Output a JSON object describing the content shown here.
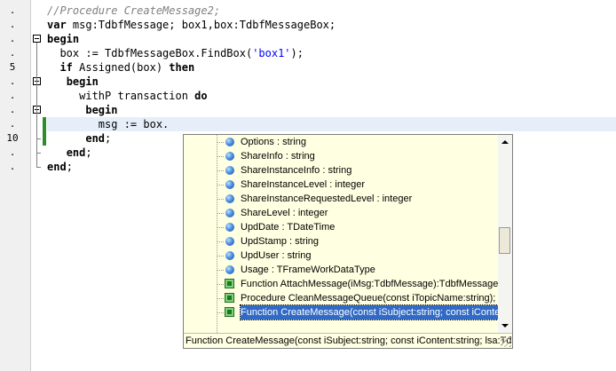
{
  "gutter": {
    "lines": [
      ".",
      ".",
      ".",
      ".",
      "5",
      ".",
      ".",
      ".",
      ".",
      "10",
      ".",
      "."
    ]
  },
  "code": {
    "lines": [
      [
        {
          "t": "//Procedure CreateMessage2;",
          "c": "cmt"
        }
      ],
      [
        {
          "t": "var",
          "c": "kw"
        },
        {
          "t": " msg:TdbfMessage; box1,box:TdbfMessageBox;",
          "c": ""
        }
      ],
      [
        {
          "t": "begin",
          "c": "kw"
        }
      ],
      [
        {
          "t": "  box := TdbfMessageBox.FindBox(",
          "c": ""
        },
        {
          "t": "'box1'",
          "c": "str"
        },
        {
          "t": ");",
          "c": ""
        }
      ],
      [
        {
          "t": "  ",
          "c": ""
        },
        {
          "t": "if",
          "c": "kw"
        },
        {
          "t": " Assigned(box) ",
          "c": ""
        },
        {
          "t": "then",
          "c": "kw"
        }
      ],
      [
        {
          "t": "   ",
          "c": ""
        },
        {
          "t": "begin",
          "c": "kw"
        }
      ],
      [
        {
          "t": "     withP transaction ",
          "c": ""
        },
        {
          "t": "do",
          "c": "kw"
        }
      ],
      [
        {
          "t": "      ",
          "c": ""
        },
        {
          "t": "begin",
          "c": "kw"
        }
      ],
      [
        {
          "t": "        msg := box.",
          "c": ""
        }
      ],
      [
        {
          "t": "      ",
          "c": ""
        },
        {
          "t": "end",
          "c": "kw"
        },
        {
          "t": ";",
          "c": ""
        }
      ],
      [
        {
          "t": "   ",
          "c": ""
        },
        {
          "t": "end",
          "c": "kw"
        },
        {
          "t": ";",
          "c": ""
        }
      ],
      [
        {
          "t": "end",
          "c": "kw"
        },
        {
          "t": ";",
          "c": ""
        }
      ]
    ]
  },
  "popup": {
    "items": [
      {
        "icon": "property-icon",
        "label": "Options : string"
      },
      {
        "icon": "property-icon",
        "label": "ShareInfo : string"
      },
      {
        "icon": "property-icon",
        "label": "ShareInstanceInfo : string"
      },
      {
        "icon": "property-icon",
        "label": "ShareInstanceLevel : integer"
      },
      {
        "icon": "property-icon",
        "label": "ShareInstanceRequestedLevel : integer"
      },
      {
        "icon": "property-icon",
        "label": "ShareLevel : integer"
      },
      {
        "icon": "property-icon",
        "label": "UpdDate : TDateTime"
      },
      {
        "icon": "property-icon",
        "label": "UpdStamp : string"
      },
      {
        "icon": "property-icon",
        "label": "UpdUser : string"
      },
      {
        "icon": "property-icon",
        "label": "Usage : TFrameWorkDataType"
      },
      {
        "icon": "method-icon",
        "label": "Function AttachMessage(iMsg:TdbfMessage):TdbfMessageB"
      },
      {
        "icon": "method-icon",
        "label": "Procedure CleanMessageQueue(const iTopicName:string);"
      },
      {
        "icon": "method-icon",
        "label": "Function CreateMessage(const iSubject:string; const iConten"
      }
    ],
    "selected_index": 12,
    "hint": "Function CreateMessage(const iSubject:string; const iContent:string; lsa:Tdl"
  }
}
